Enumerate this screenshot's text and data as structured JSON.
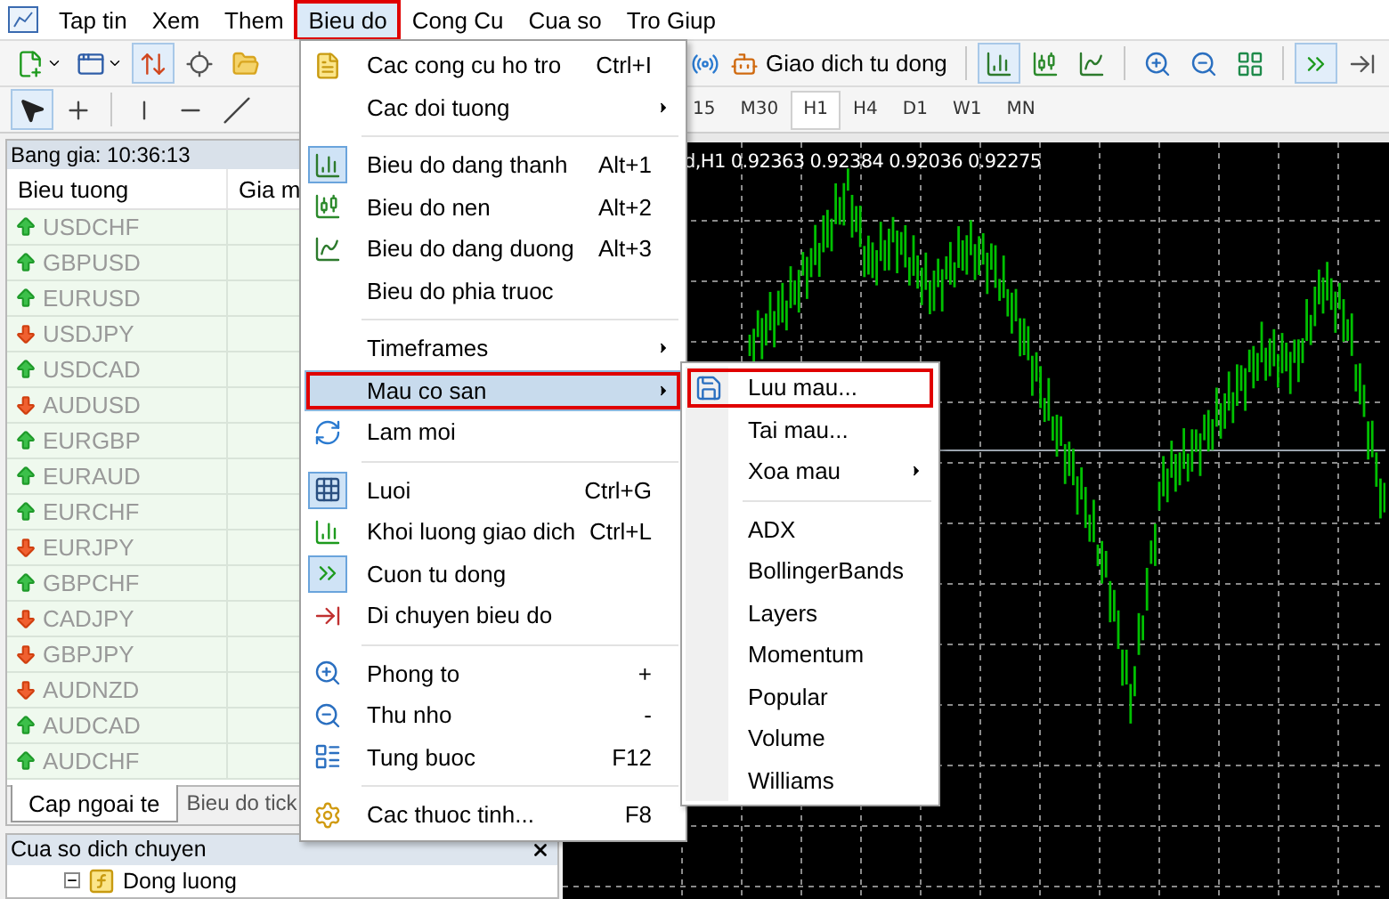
{
  "menu_bar": [
    {
      "label": "Tap tin",
      "open": false,
      "annotated": false
    },
    {
      "label": "Xem",
      "open": false,
      "annotated": false
    },
    {
      "label": "Them",
      "open": false,
      "annotated": false
    },
    {
      "label": "Bieu do",
      "open": true,
      "annotated": true
    },
    {
      "label": "Cong Cu",
      "open": false,
      "annotated": false
    },
    {
      "label": "Cua so",
      "open": false,
      "annotated": false
    },
    {
      "label": "Tro Giup",
      "open": false,
      "annotated": false
    }
  ],
  "toolbar": {
    "left_buttons": [
      {
        "pressed": false
      },
      {
        "pressed": false
      },
      {
        "pressed": true
      },
      {
        "pressed": false
      },
      {
        "pressed": false
      }
    ],
    "auto_trading": {
      "label": "Giao dich tu dong"
    },
    "right_buttons": [
      {
        "pressed": true
      },
      {
        "pressed": false
      },
      {
        "pressed": false
      },
      {
        "pressed": false
      },
      {
        "pressed": false
      },
      {
        "pressed": false
      },
      {
        "pressed": true
      },
      {
        "pressed": false
      }
    ]
  },
  "drawing_toolbar": {
    "tools": [
      {
        "pressed": true
      },
      {
        "pressed": false
      },
      {
        "pressed": false
      },
      {
        "pressed": false
      },
      {
        "pressed": false
      }
    ],
    "timeframes": [
      {
        "label": "15",
        "selected": false
      },
      {
        "label": "M30",
        "selected": false
      },
      {
        "label": "H1",
        "selected": true
      },
      {
        "label": "H4",
        "selected": false
      },
      {
        "label": "D1",
        "selected": false
      },
      {
        "label": "W1",
        "selected": false
      },
      {
        "label": "MN",
        "selected": false
      }
    ]
  },
  "market_watch": {
    "title": "Bang gia: 10:36:13",
    "columns": [
      "Bieu tuong",
      "Gia m"
    ],
    "rows": [
      {
        "symbol": "USDCHF",
        "rising": true
      },
      {
        "symbol": "GBPUSD",
        "rising": true
      },
      {
        "symbol": "EURUSD",
        "rising": true
      },
      {
        "symbol": "USDJPY",
        "rising": false
      },
      {
        "symbol": "USDCAD",
        "rising": true
      },
      {
        "symbol": "AUDUSD",
        "rising": false
      },
      {
        "symbol": "EURGBP",
        "rising": true
      },
      {
        "symbol": "EURAUD",
        "rising": true
      },
      {
        "symbol": "EURCHF",
        "rising": true
      },
      {
        "symbol": "EURJPY",
        "rising": false
      },
      {
        "symbol": "GBPCHF",
        "rising": true
      },
      {
        "symbol": "CADJPY",
        "rising": false
      },
      {
        "symbol": "GBPJPY",
        "rising": false
      },
      {
        "symbol": "AUDNZD",
        "rising": false
      },
      {
        "symbol": "AUDCAD",
        "rising": true
      },
      {
        "symbol": "AUDCHF",
        "rising": true
      }
    ],
    "tabs": [
      {
        "label": "Cap ngoai te",
        "selected": true
      },
      {
        "label": "Bieu do tick",
        "selected": false
      }
    ]
  },
  "navigator": {
    "title": "Cua so dich chuyen",
    "items": [
      {
        "label": "Dong luong",
        "expanded": true
      }
    ]
  },
  "chart": {
    "title": "d,H1  0.92363 0.92384 0.92036 0.92275"
  },
  "chart_menu": [
    {
      "kind": "item",
      "label": "Cac cong cu ho tro",
      "shortcut": "Ctrl+I",
      "submenu": false,
      "checked": false,
      "highlighted": false,
      "annotated": false
    },
    {
      "kind": "item",
      "label": "Cac doi tuong",
      "submenu": true,
      "checked": false,
      "highlighted": false,
      "annotated": false
    },
    {
      "kind": "separator"
    },
    {
      "kind": "item",
      "label": "Bieu do dang thanh",
      "shortcut": "Alt+1",
      "submenu": false,
      "checked": true,
      "highlighted": false,
      "annotated": false
    },
    {
      "kind": "item",
      "label": "Bieu do nen",
      "shortcut": "Alt+2",
      "submenu": false,
      "checked": false,
      "highlighted": false,
      "annotated": false
    },
    {
      "kind": "item",
      "label": "Bieu do dang duong",
      "shortcut": "Alt+3",
      "submenu": false,
      "checked": false,
      "highlighted": false,
      "annotated": false
    },
    {
      "kind": "item",
      "label": "Bieu do phia truoc",
      "submenu": false,
      "checked": false,
      "highlighted": false,
      "annotated": false
    },
    {
      "kind": "separator"
    },
    {
      "kind": "item",
      "label": "Timeframes",
      "submenu": true,
      "checked": false,
      "highlighted": false,
      "annotated": false
    },
    {
      "kind": "item",
      "label": "Mau co san",
      "submenu": true,
      "checked": false,
      "highlighted": true,
      "annotated": true
    },
    {
      "kind": "item",
      "label": "Lam moi",
      "submenu": false,
      "checked": false,
      "highlighted": false,
      "annotated": false
    },
    {
      "kind": "separator"
    },
    {
      "kind": "item",
      "label": "Luoi",
      "shortcut": "Ctrl+G",
      "submenu": false,
      "checked": true,
      "highlighted": false,
      "annotated": false
    },
    {
      "kind": "item",
      "label": "Khoi luong giao dich",
      "shortcut": "Ctrl+L",
      "submenu": false,
      "checked": false,
      "highlighted": false,
      "annotated": false
    },
    {
      "kind": "item",
      "label": "Cuon tu dong",
      "submenu": false,
      "checked": true,
      "highlighted": false,
      "annotated": false
    },
    {
      "kind": "item",
      "label": "Di chuyen bieu do",
      "submenu": false,
      "checked": false,
      "highlighted": false,
      "annotated": false
    },
    {
      "kind": "separator"
    },
    {
      "kind": "item",
      "label": "Phong to",
      "shortcut": "+",
      "submenu": false,
      "checked": false,
      "highlighted": false,
      "annotated": false
    },
    {
      "kind": "item",
      "label": "Thu nho",
      "shortcut": "-",
      "submenu": false,
      "checked": false,
      "highlighted": false,
      "annotated": false
    },
    {
      "kind": "item",
      "label": "Tung buoc",
      "shortcut": "F12",
      "submenu": false,
      "checked": false,
      "highlighted": false,
      "annotated": false
    },
    {
      "kind": "separator"
    },
    {
      "kind": "item",
      "label": "Cac thuoc tinh...",
      "shortcut": "F8",
      "submenu": false,
      "checked": false,
      "highlighted": false,
      "annotated": false
    }
  ],
  "template_menu": [
    {
      "kind": "item",
      "label": "Luu mau...",
      "submenu": false,
      "annotated": true
    },
    {
      "kind": "item",
      "label": "Tai mau...",
      "submenu": false,
      "annotated": false
    },
    {
      "kind": "item",
      "label": "Xoa mau",
      "submenu": true,
      "annotated": false
    },
    {
      "kind": "separator"
    },
    {
      "kind": "item",
      "label": "ADX",
      "submenu": false,
      "annotated": false
    },
    {
      "kind": "item",
      "label": "BollingerBands",
      "submenu": false,
      "annotated": false
    },
    {
      "kind": "item",
      "label": "Layers",
      "submenu": false,
      "annotated": false
    },
    {
      "kind": "item",
      "label": "Momentum",
      "submenu": false,
      "annotated": false
    },
    {
      "kind": "item",
      "label": "Popular",
      "submenu": false,
      "annotated": false
    },
    {
      "kind": "item",
      "label": "Volume",
      "submenu": false,
      "annotated": false
    },
    {
      "kind": "item",
      "label": "Williams",
      "submenu": false,
      "annotated": false
    }
  ]
}
